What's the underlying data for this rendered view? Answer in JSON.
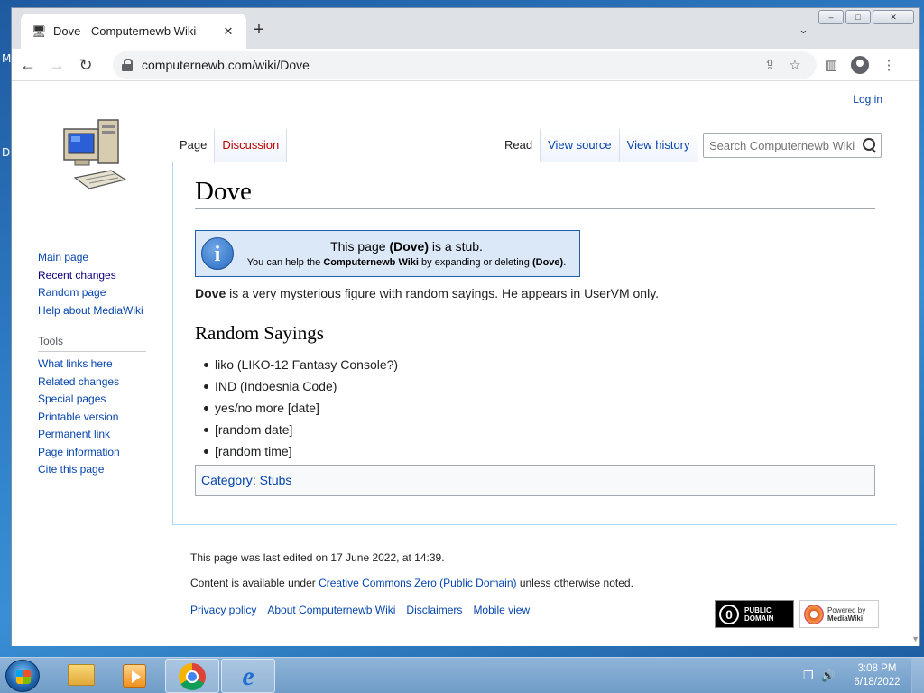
{
  "browser": {
    "tab_title": "Dove - Computernewb Wiki",
    "url": "computernewb.com/wiki/Dove",
    "new_tab": "+",
    "tab_close": "✕"
  },
  "wiki": {
    "login": "Log in",
    "tabs_left": [
      "Page",
      "Discussion"
    ],
    "tabs_right": [
      "Read",
      "View source",
      "View history"
    ],
    "search_placeholder": "Search Computernewb Wiki",
    "sidebar": {
      "nav": [
        "Main page",
        "Recent changes",
        "Random page",
        "Help about MediaWiki"
      ],
      "tools_heading": "Tools",
      "tools": [
        "What links here",
        "Related changes",
        "Special pages",
        "Printable version",
        "Permanent link",
        "Page information",
        "Cite this page"
      ]
    },
    "title": "Dove",
    "stub": {
      "line1_pre": "This page ",
      "line1_bold": "(Dove)",
      "line1_post": " is a stub.",
      "line2_pre": "You can help the ",
      "line2_bold1": "Computernewb Wiki",
      "line2_mid": " by expanding or deleting ",
      "line2_bold2": "(Dove)",
      "line2_post": "."
    },
    "intro_bold": "Dove",
    "intro_rest": " is a very mysterious figure with random sayings. He appears in UserVM only.",
    "section_title": "Random Sayings",
    "sayings": [
      "liko (LIKO-12 Fantasy Console?)",
      "IND (Indoesnia Code)",
      "yes/no more [date]",
      "[random date]",
      "[random time]"
    ],
    "category_label": "Category",
    "category_sep": ":  ",
    "category_link": "Stubs",
    "footer": {
      "last_edited": "This page was last edited on 17 June 2022, at 14:39.",
      "content_pre": "Content is available under ",
      "content_link": "Creative Commons Zero (Public Domain)",
      "content_post": " unless otherwise noted.",
      "links": [
        "Privacy policy",
        "About Computernewb Wiki",
        "Disclaimers",
        "Mobile view"
      ],
      "badge_pd": [
        "PUBLIC",
        "DOMAIN"
      ],
      "badge_mw": [
        "Powered by",
        "MediaWiki"
      ]
    }
  },
  "taskbar": {
    "time": "3:08 PM",
    "date": "6/18/2022"
  }
}
